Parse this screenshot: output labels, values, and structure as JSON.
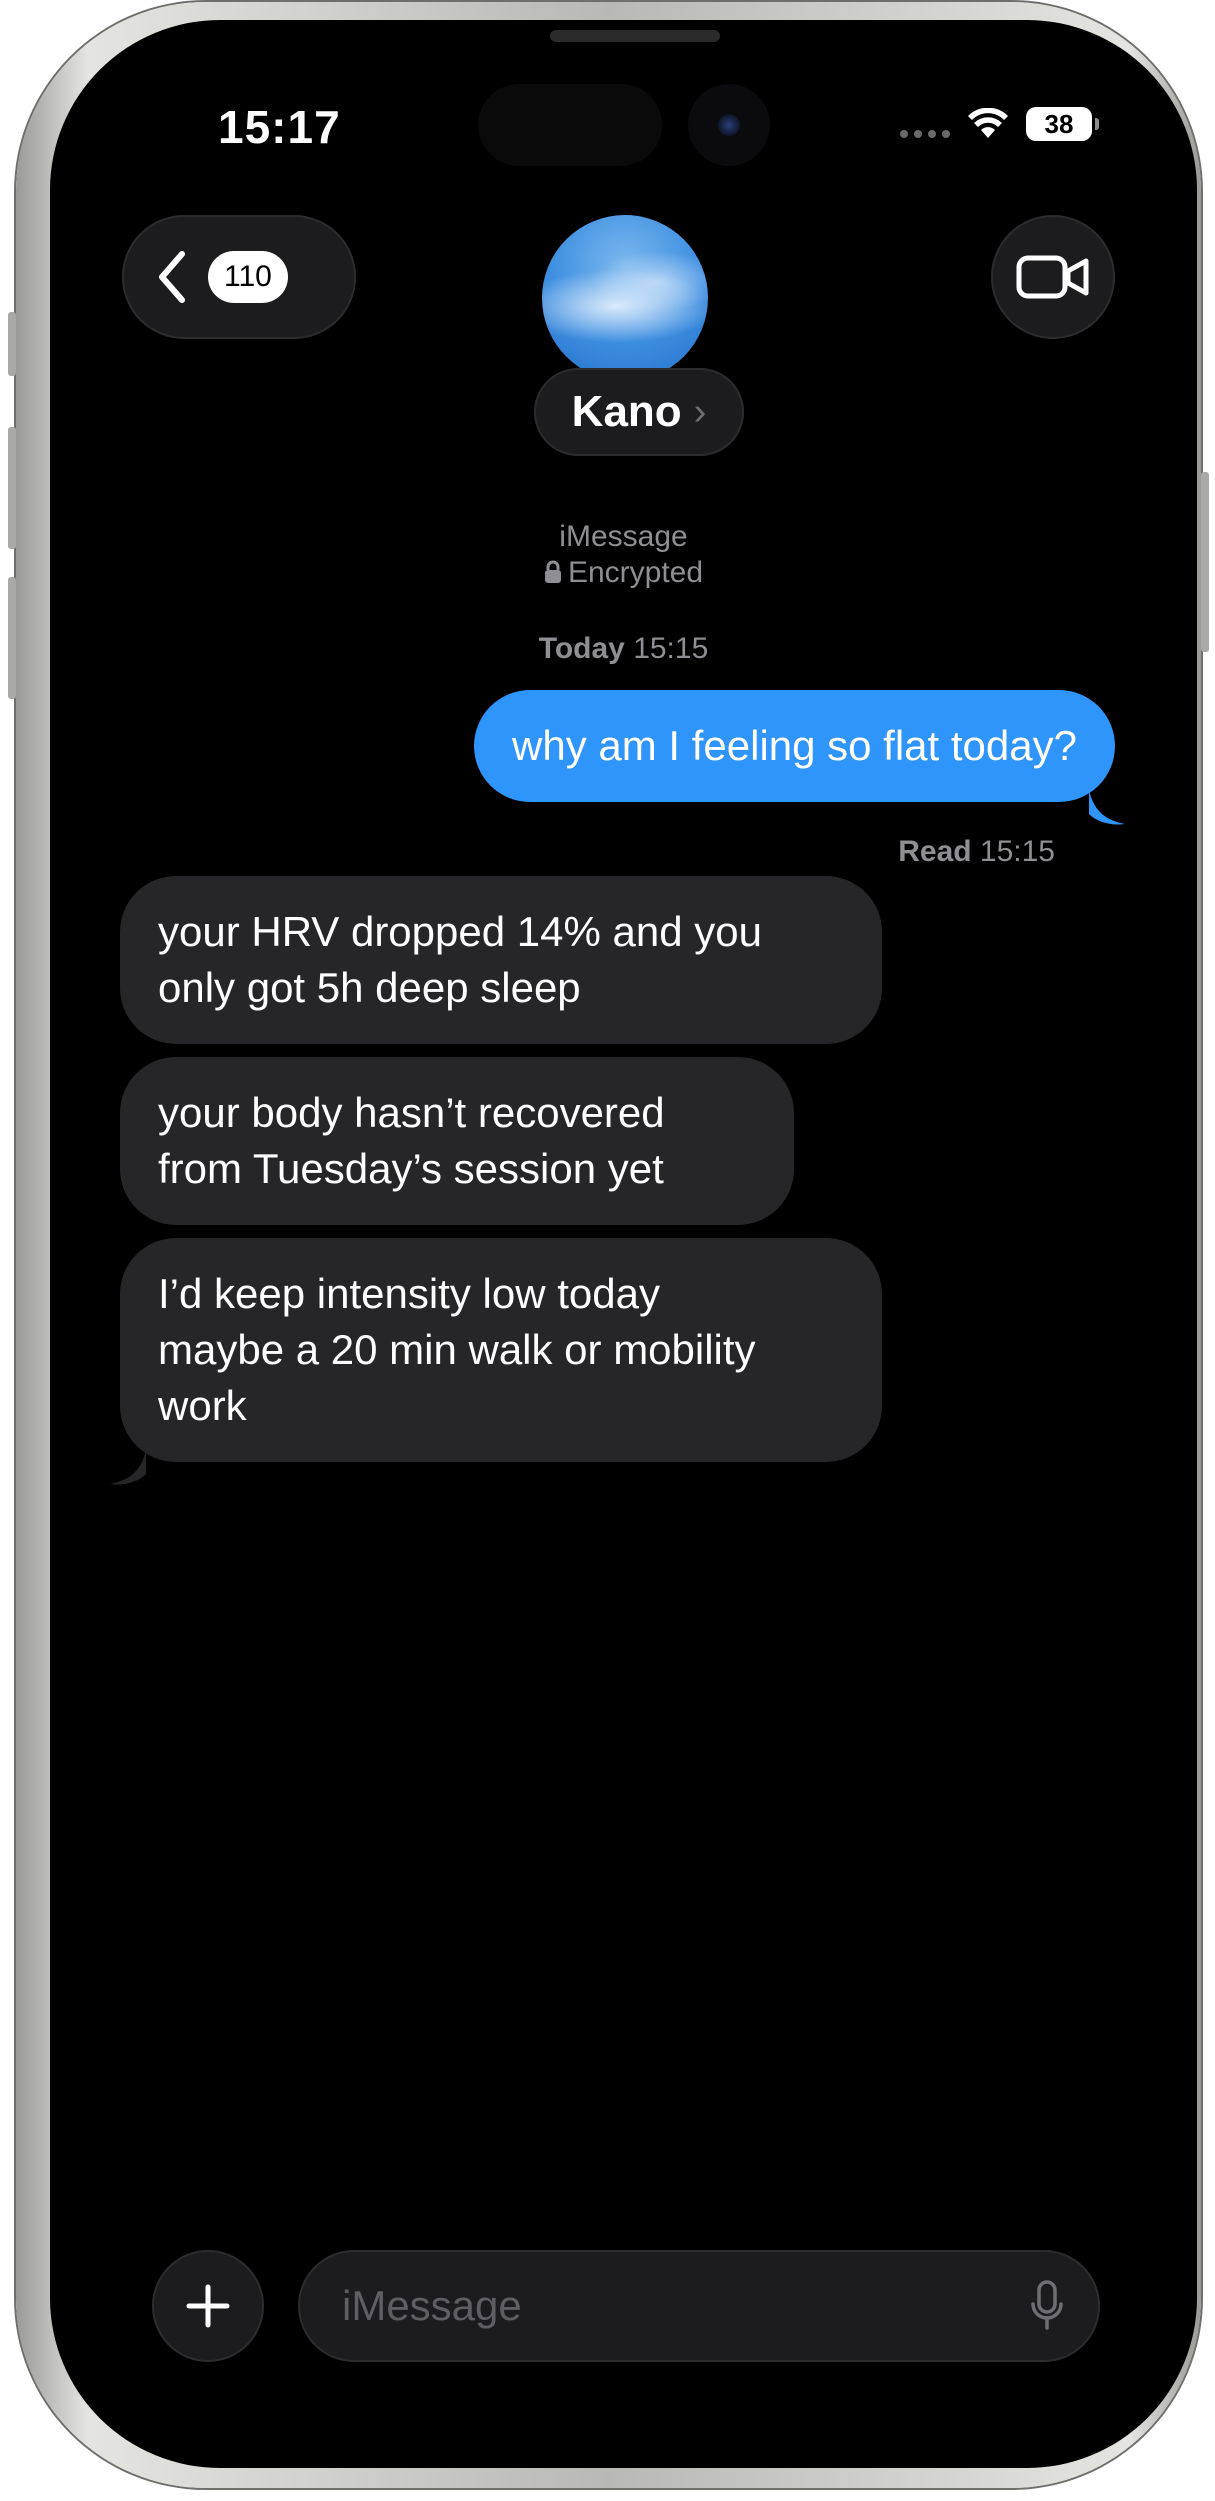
{
  "status_bar": {
    "time": "15:17",
    "battery": "38"
  },
  "header": {
    "back_count": "110",
    "contact_name": "Kano",
    "name_chevron": "›"
  },
  "thread": {
    "service": "iMessage",
    "encryption": "Encrypted",
    "timestamp_day": "Today",
    "timestamp_time": "15:15",
    "read_label": "Read",
    "read_time": "15:15"
  },
  "messages": {
    "outgoing": "why am I feeling so flat today?",
    "incoming_1_line1": "your HRV dropped 14% and you",
    "incoming_1_line2": "only got 5h deep sleep",
    "incoming_2_line1": "your body hasn’t recovered",
    "incoming_2_line2": "from Tuesday’s session yet",
    "incoming_3_line1": "I’d keep intensity low today",
    "incoming_3_line2": "maybe a 20 min walk or mobility",
    "incoming_3_line3": "work"
  },
  "composer": {
    "placeholder": "iMessage"
  },
  "icons": {
    "back": "chevron-left-icon",
    "video": "video-camera-icon",
    "lock": "lock-icon",
    "plus": "plus-icon",
    "mic": "microphone-icon",
    "wifi": "wifi-icon"
  },
  "colors": {
    "outgoing_bubble": "#2f95fb",
    "incoming_bubble": "#262628",
    "background": "#000000"
  }
}
